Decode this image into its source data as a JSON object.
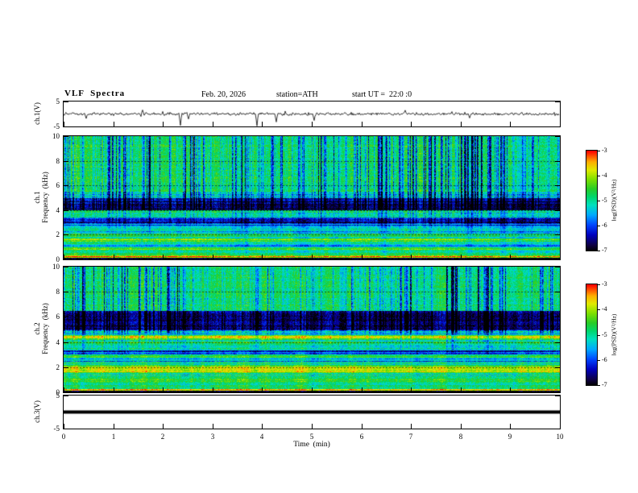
{
  "title": "VLF  Spectra",
  "header": {
    "date": "Feb. 20, 2026",
    "station": "station=ATH",
    "start_ut": "start UT =  22:0 :0"
  },
  "x_axis": {
    "label": "Time  (min)",
    "range": [
      0,
      10
    ],
    "ticks": [
      0,
      1,
      2,
      3,
      4,
      5,
      6,
      7,
      8,
      9,
      10
    ]
  },
  "panels": {
    "ch1_wave": {
      "ylabel": "ch.1(V)",
      "ylim": [
        -5,
        5
      ],
      "yticks": [
        5,
        -5
      ]
    },
    "ch1_spec": {
      "channel_label": "ch.1",
      "axis_label": "Frequency  (kHz)",
      "ylim": [
        0,
        10
      ],
      "yticks": [
        0,
        2,
        4,
        6,
        8,
        10
      ]
    },
    "ch2_spec": {
      "channel_label": "ch.2",
      "axis_label": "Frequency  (kHz)",
      "ylim": [
        0,
        10
      ],
      "yticks": [
        0,
        2,
        4,
        6,
        8,
        10
      ]
    },
    "ch3_wave": {
      "ylabel": "ch.3(V)",
      "ylim": [
        -5,
        5
      ],
      "yticks": [
        5,
        -5
      ]
    }
  },
  "colorbar": {
    "label": "log(PSD)(V²/Hz)",
    "range": [
      -7,
      -3
    ],
    "ticks": [
      -3,
      -4,
      -5,
      -6,
      -7
    ]
  },
  "chart_data": [
    {
      "type": "line",
      "name": "ch.1 waveform",
      "ylabel": "ch.1(V)",
      "xlim": [
        0,
        10
      ],
      "ylim": [
        -5,
        5
      ],
      "noise_amp_v": 0.7,
      "spikes": [
        {
          "t_min": 0.45,
          "amp_v": -1.8
        },
        {
          "t_min": 1.6,
          "amp_v": 1.6
        },
        {
          "t_min": 2.35,
          "amp_v": -4.6
        },
        {
          "t_min": 2.52,
          "amp_v": -2.0
        },
        {
          "t_min": 3.9,
          "amp_v": -4.8
        },
        {
          "t_min": 4.3,
          "amp_v": -3.2
        },
        {
          "t_min": 5.05,
          "amp_v": -2.6
        },
        {
          "t_min": 6.9,
          "amp_v": 1.5
        },
        {
          "t_min": 8.2,
          "amp_v": -1.6
        }
      ]
    },
    {
      "type": "heatmap",
      "name": "ch.1 spectrogram",
      "xlabel": "Time (min)",
      "ylabel": "Frequency (kHz)",
      "xlim": [
        0,
        10
      ],
      "ylim": [
        0,
        10
      ],
      "zlabel": "log(PSD)(V²/Hz)",
      "zlim": [
        -7,
        -3
      ],
      "grid_khz": [
        2,
        4,
        6,
        8
      ],
      "bands": [
        {
          "f": [
            0.0,
            0.18
          ],
          "level": -6.9
        },
        {
          "f": [
            0.18,
            0.3
          ],
          "level": -3.6
        },
        {
          "f": [
            0.3,
            0.55
          ],
          "level": -4.7
        },
        {
          "f": [
            0.55,
            0.8
          ],
          "level": -5.1
        },
        {
          "f": [
            0.8,
            1.0
          ],
          "level": -4.4
        },
        {
          "f": [
            1.0,
            1.5
          ],
          "level": -5.4
        },
        {
          "f": [
            1.5,
            1.7
          ],
          "level": -4.3
        },
        {
          "f": [
            1.7,
            2.15
          ],
          "level": -4.9
        },
        {
          "f": [
            2.15,
            2.35
          ],
          "level": -5.5
        },
        {
          "f": [
            2.35,
            2.65
          ],
          "level": -4.9
        },
        {
          "f": [
            2.65,
            3.0
          ],
          "level": -5.7
        },
        {
          "f": [
            3.0,
            3.45
          ],
          "level": -6.3
        },
        {
          "f": [
            3.45,
            4.0
          ],
          "level": -4.9
        },
        {
          "f": [
            4.0,
            5.0
          ],
          "level": -6.6
        },
        {
          "f": [
            5.0,
            5.35
          ],
          "level": -5.2
        },
        {
          "f": [
            5.35,
            10.01
          ],
          "level": -4.7
        }
      ],
      "streaks": {
        "f_min_khz": 4.0,
        "density": 0.5,
        "max_extra_atten": 2.4
      }
    },
    {
      "type": "heatmap",
      "name": "ch.2 spectrogram",
      "xlabel": "Time (min)",
      "ylabel": "Frequency (kHz)",
      "xlim": [
        0,
        10
      ],
      "ylim": [
        0,
        10
      ],
      "zlabel": "log(PSD)(V²/Hz)",
      "zlim": [
        -7,
        -3
      ],
      "grid_khz": [
        2,
        4,
        6,
        8
      ],
      "bands": [
        {
          "f": [
            0.0,
            0.18
          ],
          "level": -6.9
        },
        {
          "f": [
            0.18,
            0.3
          ],
          "level": -3.5
        },
        {
          "f": [
            0.3,
            0.6
          ],
          "level": -4.6
        },
        {
          "f": [
            0.6,
            0.8
          ],
          "level": -5.1
        },
        {
          "f": [
            0.8,
            1.2
          ],
          "level": -4.4
        },
        {
          "f": [
            1.2,
            1.55
          ],
          "level": -4.9
        },
        {
          "f": [
            1.55,
            2.2
          ],
          "level": -4.05
        },
        {
          "f": [
            2.2,
            2.5
          ],
          "level": -4.9
        },
        {
          "f": [
            2.5,
            2.7
          ],
          "level": -5.5
        },
        {
          "f": [
            2.7,
            3.05
          ],
          "level": -4.8
        },
        {
          "f": [
            3.05,
            3.35
          ],
          "level": -6.0
        },
        {
          "f": [
            3.35,
            4.35
          ],
          "level": -4.8
        },
        {
          "f": [
            4.35,
            4.6
          ],
          "level": -4.1
        },
        {
          "f": [
            4.6,
            5.0
          ],
          "level": -5.3
        },
        {
          "f": [
            5.0,
            6.5
          ],
          "level": -6.5
        },
        {
          "f": [
            6.5,
            10.01
          ],
          "level": -4.75
        }
      ],
      "streaks": {
        "f_min_khz": 4.8,
        "density": 0.45,
        "max_extra_atten": 2.4
      }
    },
    {
      "type": "line",
      "name": "ch.3 waveform",
      "ylabel": "ch.3(V)",
      "xlim": [
        0,
        10
      ],
      "ylim": [
        -5,
        5
      ],
      "constant_v": 0
    }
  ]
}
